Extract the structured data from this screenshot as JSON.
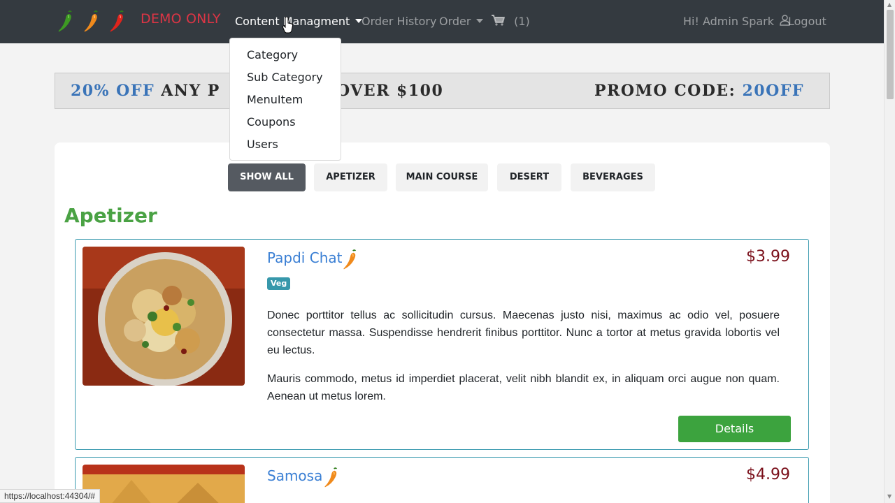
{
  "navbar": {
    "brand": "DEMO ONLY",
    "logo_icons": [
      "chili-green-icon",
      "chili-orange-icon",
      "chili-red-icon"
    ],
    "content_management": "Content Managment",
    "order_history": "Order History",
    "order": "Order",
    "cart_count": "(1)",
    "greeting": "Hi! Admin Spark",
    "logout": "Logout"
  },
  "dropdown": {
    "items": [
      "Category",
      "Sub Category",
      "MenuItem",
      "Coupons",
      "Users"
    ]
  },
  "promo": {
    "left_highlight": "20% OFF",
    "left_text": "ANY P",
    "middle_text": "OVER $100",
    "right_text": "PROMO CODE:",
    "right_code": "20OFF"
  },
  "filters": [
    "SHOW ALL",
    "APETIZER",
    "MAIN COURSE",
    "DESERT",
    "BEVERAGES"
  ],
  "section_title": "Apetizer",
  "items": [
    {
      "name": "Papdi Chat",
      "price": "$3.99",
      "badge": "Veg",
      "spice_icon": "chili-orange-icon",
      "desc1": "Donec porttitor tellus ac sollicitudin cursus. Maecenas justo nisi, maximus ac odio vel, posuere consectetur massa. Suspendisse hendrerit finibus porttitor. Nunc a tortor at metus gravida lobortis vel eu lectus.",
      "desc2": "Mauris commodo, metus id imperdiet placerat, velit nibh blandit ex, in aliquam orci augue non quam. Aenean ut metus lorem.",
      "details": "Details"
    },
    {
      "name": "Samosa",
      "price": "$4.99",
      "spice_icon": "chili-orange-icon"
    }
  ],
  "status_url": "https://localhost:44304/#",
  "colors": {
    "navbar": "#343a40",
    "brand": "#dc3545",
    "section_title": "#4aa244",
    "card_border": "#3899ae",
    "item_name": "#3a7fd4",
    "price": "#7a0f1a",
    "details_button": "#3ca33e"
  }
}
